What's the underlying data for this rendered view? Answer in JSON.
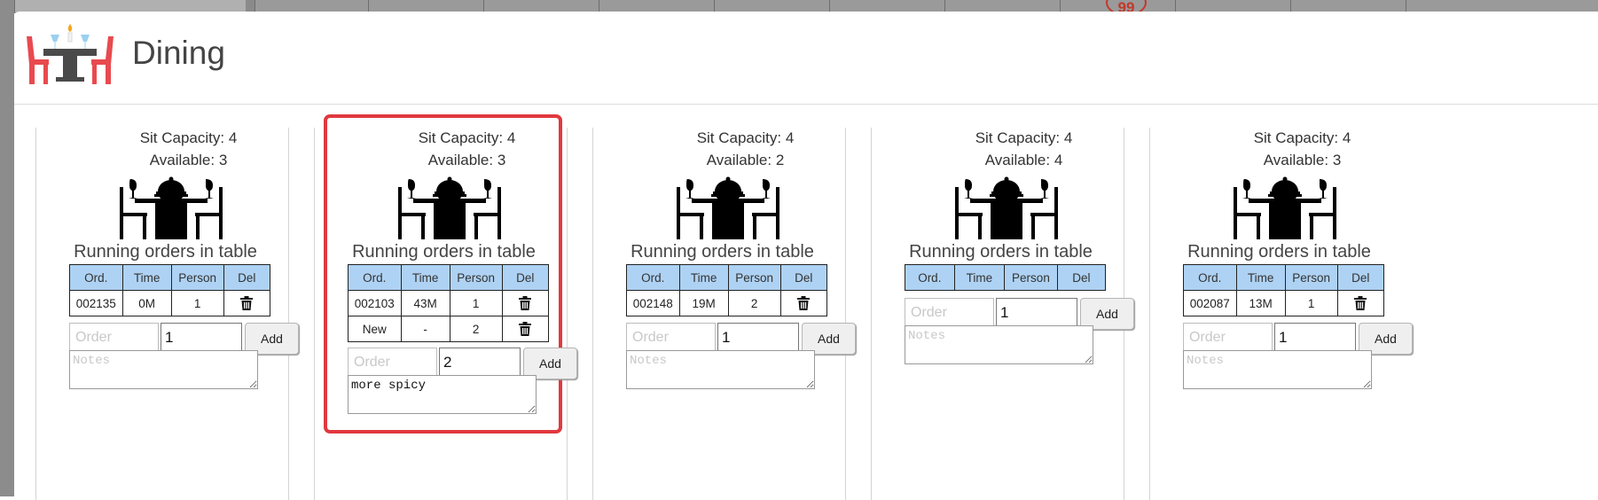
{
  "modal": {
    "title": "Dining"
  },
  "background": {
    "badge": "99"
  },
  "tables": [
    {
      "capacity_label": "Sit Capacity: 4",
      "available_label": "Available: 3",
      "running_label": "Running orders in table",
      "headers": [
        "Ord.",
        "Time",
        "Person",
        "Del"
      ],
      "rows": [
        {
          "order": "002135",
          "time": "0M",
          "person": "1"
        }
      ],
      "order_placeholder": "Order",
      "qty_value": "1",
      "add_label": "Add",
      "notes_placeholder": "Notes",
      "notes_value": "",
      "selected": false
    },
    {
      "capacity_label": "Sit Capacity: 4",
      "available_label": "Available: 3",
      "running_label": "Running orders in table",
      "headers": [
        "Ord.",
        "Time",
        "Person",
        "Del"
      ],
      "rows": [
        {
          "order": "002103",
          "time": "43M",
          "person": "1"
        },
        {
          "order": "New",
          "time": "-",
          "person": "2"
        }
      ],
      "order_placeholder": "Order",
      "qty_value": "2",
      "add_label": "Add",
      "notes_placeholder": "Notes",
      "notes_value": "more spicy",
      "selected": true
    },
    {
      "capacity_label": "Sit Capacity: 4",
      "available_label": "Available: 2",
      "running_label": "Running orders in table",
      "headers": [
        "Ord.",
        "Time",
        "Person",
        "Del"
      ],
      "rows": [
        {
          "order": "002148",
          "time": "19M",
          "person": "2"
        }
      ],
      "order_placeholder": "Order",
      "qty_value": "1",
      "add_label": "Add",
      "notes_placeholder": "Notes",
      "notes_value": "",
      "selected": false
    },
    {
      "capacity_label": "Sit Capacity: 4",
      "available_label": "Available: 4",
      "running_label": "Running orders in table",
      "headers": [
        "Ord.",
        "Time",
        "Person",
        "Del"
      ],
      "rows": [],
      "order_placeholder": "Order",
      "qty_value": "1",
      "add_label": "Add",
      "notes_placeholder": "Notes",
      "notes_value": "",
      "selected": false
    },
    {
      "capacity_label": "Sit Capacity: 4",
      "available_label": "Available: 3",
      "running_label": "Running orders in table",
      "headers": [
        "Ord.",
        "Time",
        "Person",
        "Del"
      ],
      "rows": [
        {
          "order": "002087",
          "time": "13M",
          "person": "1"
        }
      ],
      "order_placeholder": "Order",
      "qty_value": "1",
      "add_label": "Add",
      "notes_placeholder": "Notes",
      "notes_value": "",
      "selected": false
    }
  ],
  "icons": {
    "logo": "dining-table-logo-icon",
    "table": "dining-table-icon",
    "delete": "trash-icon"
  },
  "colors": {
    "header_bg": "#aed2f3",
    "selected_border": "#e0393e",
    "logo_red": "#e84a4f"
  }
}
